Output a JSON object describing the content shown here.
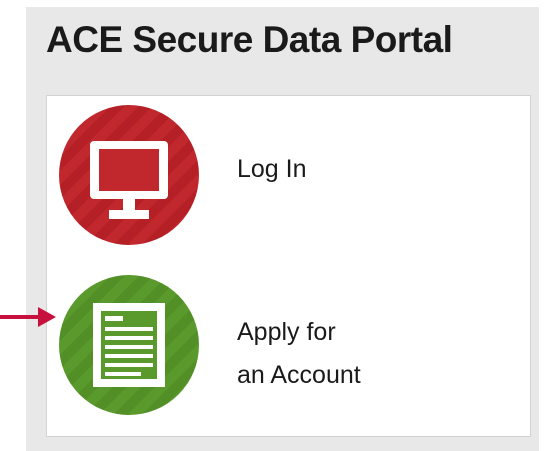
{
  "portal": {
    "title": "ACE Secure Data Portal"
  },
  "options": [
    {
      "label": "Log In",
      "icon": "monitor-icon",
      "color": "#c0282e"
    },
    {
      "label_line1": "Apply for",
      "label_line2": "an Account",
      "icon": "document-icon",
      "color": "#5a9a2c"
    }
  ],
  "annotation": {
    "arrow_color": "#c8103e",
    "points_to": "apply-account-option"
  }
}
